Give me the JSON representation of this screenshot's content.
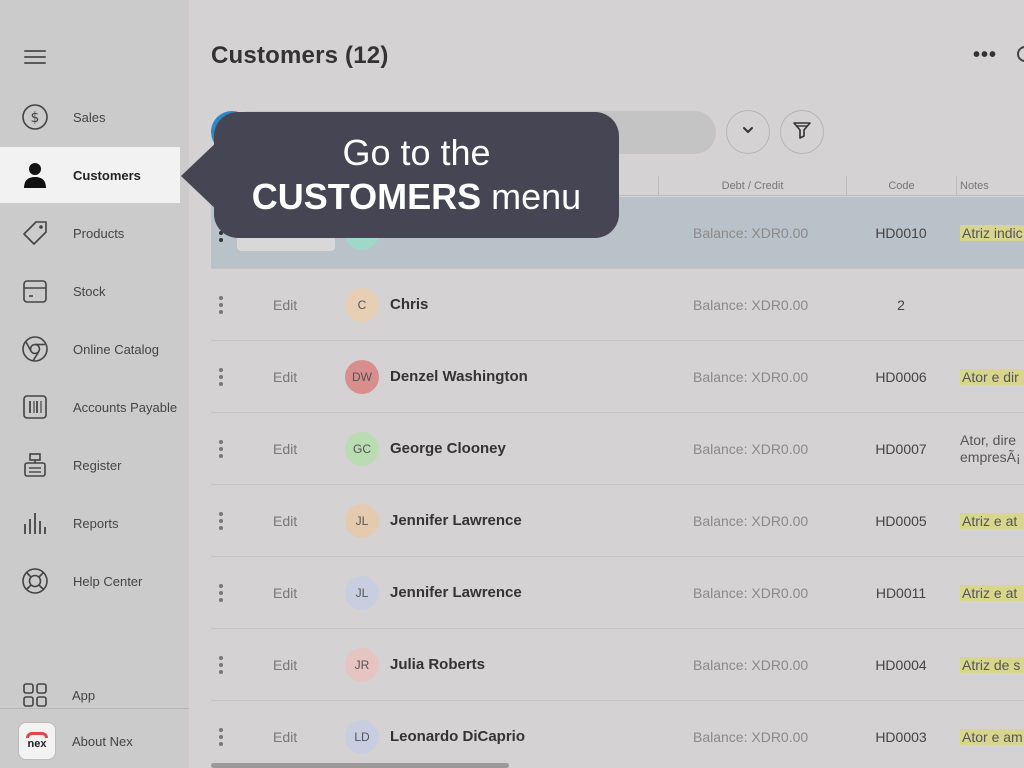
{
  "sidebar": {
    "items": [
      {
        "label": "Sales",
        "icon": "dollar-icon"
      },
      {
        "label": "Customers",
        "icon": "person-icon",
        "active": true
      },
      {
        "label": "Products",
        "icon": "tag-icon"
      },
      {
        "label": "Stock",
        "icon": "box-icon"
      },
      {
        "label": "Online Catalog",
        "icon": "chrome-icon"
      },
      {
        "label": "Accounts Payable",
        "icon": "barcode-icon"
      },
      {
        "label": "Register",
        "icon": "register-icon"
      },
      {
        "label": "Reports",
        "icon": "bar-chart-icon"
      },
      {
        "label": "Help Center",
        "icon": "lifebuoy-icon"
      }
    ],
    "app_label": "App",
    "about_label": "About Nex",
    "logo_text": "nex"
  },
  "main": {
    "title": "Customers (12)",
    "more_label": "•••",
    "columns": {
      "debt": "Debt / Credit",
      "code": "Code",
      "notes": "Notes"
    },
    "rows": [
      {
        "initials": "",
        "name": "",
        "balance": "Balance: XDR0.00",
        "code": "HD0010",
        "notes": "Atriz indic",
        "edit": "",
        "avatar_color": "#9ed8c9"
      },
      {
        "initials": "C",
        "name": "Chris",
        "balance": "Balance: XDR0.00",
        "code": "2",
        "notes": "",
        "edit": "Edit",
        "avatar_color": "#e6cfb4"
      },
      {
        "initials": "DW",
        "name": "Denzel Washington",
        "balance": "Balance: XDR0.00",
        "code": "HD0006",
        "notes": "Ator e dir",
        "edit": "Edit",
        "avatar_color": "#d98e8e"
      },
      {
        "initials": "GC",
        "name": "George Clooney",
        "balance": "Balance: XDR0.00",
        "code": "HD0007",
        "notes_line1": "Ator, dire",
        "notes_line2": "empresÃ¡",
        "edit": "Edit",
        "avatar_color": "#b9dcb2"
      },
      {
        "initials": "JL",
        "name": "Jennifer Lawrence",
        "balance": "Balance: XDR0.00",
        "code": "HD0005",
        "notes": "Atriz e at",
        "edit": "Edit",
        "avatar_color": "#e4cbb0"
      },
      {
        "initials": "JL",
        "name": "Jennifer Lawrence",
        "balance": "Balance: XDR0.00",
        "code": "HD0011",
        "notes": "Atriz e at",
        "edit": "Edit",
        "avatar_color": "#c9cde0"
      },
      {
        "initials": "JR",
        "name": "Julia Roberts",
        "balance": "Balance: XDR0.00",
        "code": "HD0004",
        "notes": "Atriz de s",
        "edit": "Edit",
        "avatar_color": "#e6c4c1"
      },
      {
        "initials": "LD",
        "name": "Leonardo DiCaprio",
        "balance": "Balance: XDR0.00",
        "code": "HD0003",
        "notes": "Ator e am",
        "edit": "Edit",
        "avatar_color": "#c9cde0"
      }
    ]
  },
  "callout": {
    "line1": "Go to the",
    "line2_bold": "CUSTOMERS",
    "line2_rest": " menu"
  },
  "colors": {
    "accent": "#2d86c7",
    "callout_bg": "#464553",
    "selected_row": "#b9c1c9",
    "note_highlight": "#d7d58e"
  }
}
